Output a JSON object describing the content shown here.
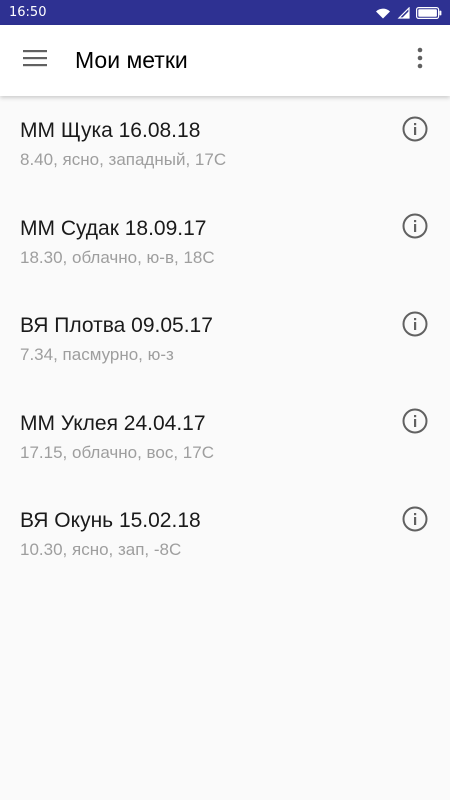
{
  "status_bar": {
    "time": "16:50",
    "icons": [
      "wifi-icon",
      "signal-icon",
      "battery-icon"
    ]
  },
  "app_bar": {
    "title": "Мои метки",
    "menu_icon": "hamburger-menu-icon",
    "overflow_icon": "more-vert-icon"
  },
  "colors": {
    "status_bar": "#2e3192",
    "app_bar": "#ffffff",
    "background": "#fafafa",
    "title_text": "#1a1a1a",
    "secondary_text": "#9e9e9e",
    "icon": "#616161"
  },
  "marks": [
    {
      "title": "ММ Щука 16.08.18",
      "subtitle": "8.40, ясно, западный, 17С",
      "icon": "info-icon"
    },
    {
      "title": "ММ Судак 18.09.17",
      "subtitle": "18.30, облачно, ю-в, 18С",
      "icon": "info-icon"
    },
    {
      "title": "ВЯ Плотва 09.05.17",
      "subtitle": "7.34, пасмурно, ю-з",
      "icon": "info-icon"
    },
    {
      "title": "ММ Уклея 24.04.17",
      "subtitle": "17.15, облачно, вос, 17С",
      "icon": "info-icon"
    },
    {
      "title": "ВЯ Окунь 15.02.18",
      "subtitle": "10.30, ясно, зап, -8С",
      "icon": "info-icon"
    }
  ]
}
